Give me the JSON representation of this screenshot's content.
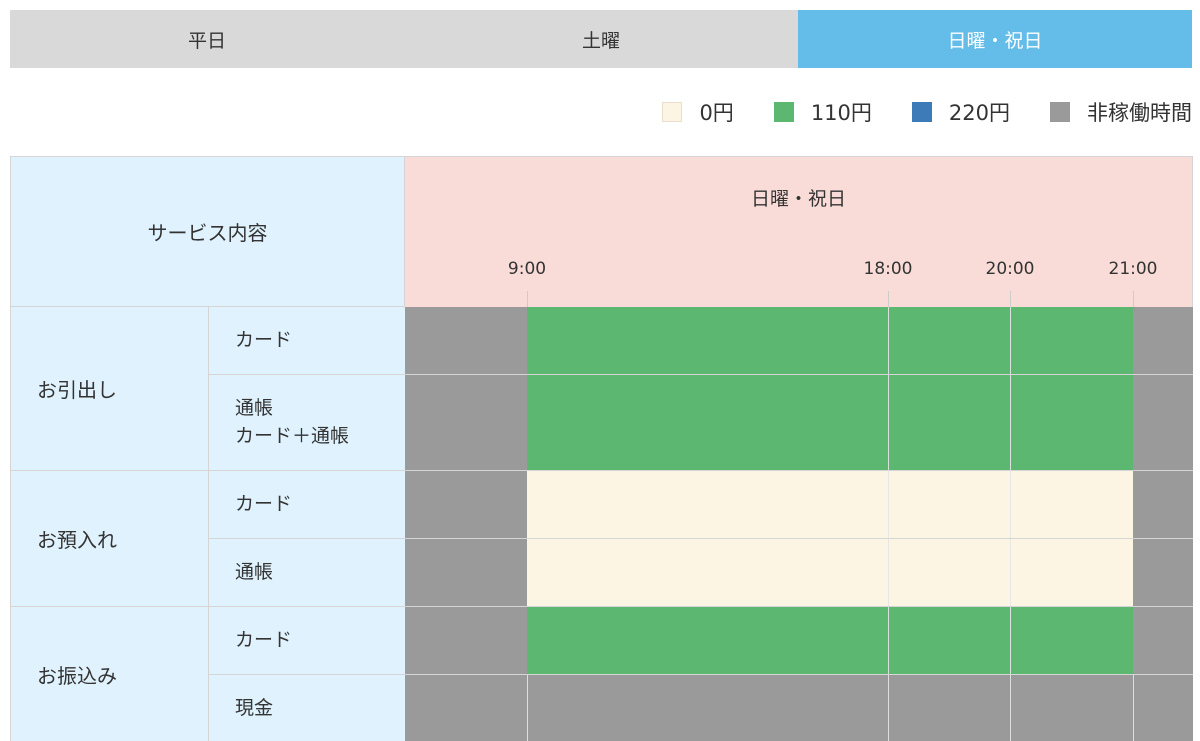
{
  "tabs": [
    {
      "label": "平日",
      "active": false
    },
    {
      "label": "土曜",
      "active": false
    },
    {
      "label": "日曜・祝日",
      "active": true
    }
  ],
  "legend": [
    {
      "label": "0円",
      "color": "#fdf5e4"
    },
    {
      "label": "110円",
      "color": "#5cb871"
    },
    {
      "label": "220円",
      "color": "#3d7ab8"
    },
    {
      "label": "非稼働時間",
      "color": "#9a9a9a"
    }
  ],
  "table": {
    "service_header": "サービス内容",
    "time_header": "日曜・祝日",
    "time_ticks": [
      "9:00",
      "18:00",
      "20:00",
      "21:00"
    ],
    "categories": [
      {
        "label": "お引出し",
        "rows": [
          {
            "lines": [
              "カード"
            ],
            "fee": "110円"
          },
          {
            "lines": [
              "通帳",
              "カード＋通帳"
            ],
            "fee": "110円"
          }
        ]
      },
      {
        "label": "お預入れ",
        "rows": [
          {
            "lines": [
              "カード"
            ],
            "fee": "0円"
          },
          {
            "lines": [
              "通帳"
            ],
            "fee": "0円"
          }
        ]
      },
      {
        "label": "お振込み",
        "rows": [
          {
            "lines": [
              "カード"
            ],
            "fee": "110円"
          },
          {
            "lines": [
              "現金"
            ],
            "fee": "非稼働時間"
          }
        ]
      }
    ]
  }
}
